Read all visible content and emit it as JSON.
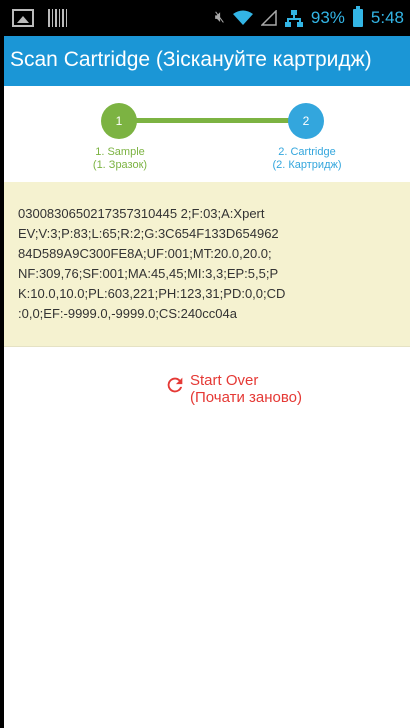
{
  "status_bar": {
    "battery": "93%",
    "time": "5:48",
    "icons": [
      "image-icon",
      "barcode-icon",
      "mute-icon",
      "wifi-icon",
      "signal-icon",
      "network-icon",
      "battery-icon"
    ]
  },
  "action_bar": {
    "title": "Scan Cartridge (Зіскануйте картридж)",
    "color": "#1b96d6"
  },
  "stepper": {
    "steps": [
      {
        "number": "1",
        "label_en": "1. Sample",
        "label_uk": "(1. Зразок)",
        "color": "#7cb342"
      },
      {
        "number": "2",
        "label_en": "2. Cartridge",
        "label_uk": "(2. Картридж)",
        "color": "#33a6dd"
      }
    ]
  },
  "scan_result": {
    "text": "0300830650217357310445 2;F:03;A:Xpert EV;V:3;P:83;L:65;R:2;G:3C654F133D654962 84D589A9C300FE8A;UF:001;MT:20.0,20.0;NF:309,76;SF:001;MA:45,45;MI:3,3;EP:5,5;P K:10.0,10.0;PL:603,221;PH:123,31;PD:0,0;CD :0,0;EF:-9999.0,-9999.0;CS:240cc04a",
    "lines": [
      "0300830650217357310445 2;F:03;A:Xpert",
      "EV;V:3;P:83;L:65;R:2;G:3C654F133D654962",
      "84D589A9C300FE8A;UF:001;MT:20.0,20.0;",
      "NF:309,76;SF:001;MA:45,45;MI:3,3;EP:5,5;P",
      "K:10.0,10.0;PL:603,221;PH:123,31;PD:0,0;CD",
      ":0,0;EF:-9999.0,-9999.0;CS:240cc04a"
    ]
  },
  "start_over": {
    "label_en": "Start Over",
    "label_uk": "(Почати заново)",
    "color": "#e53935"
  }
}
